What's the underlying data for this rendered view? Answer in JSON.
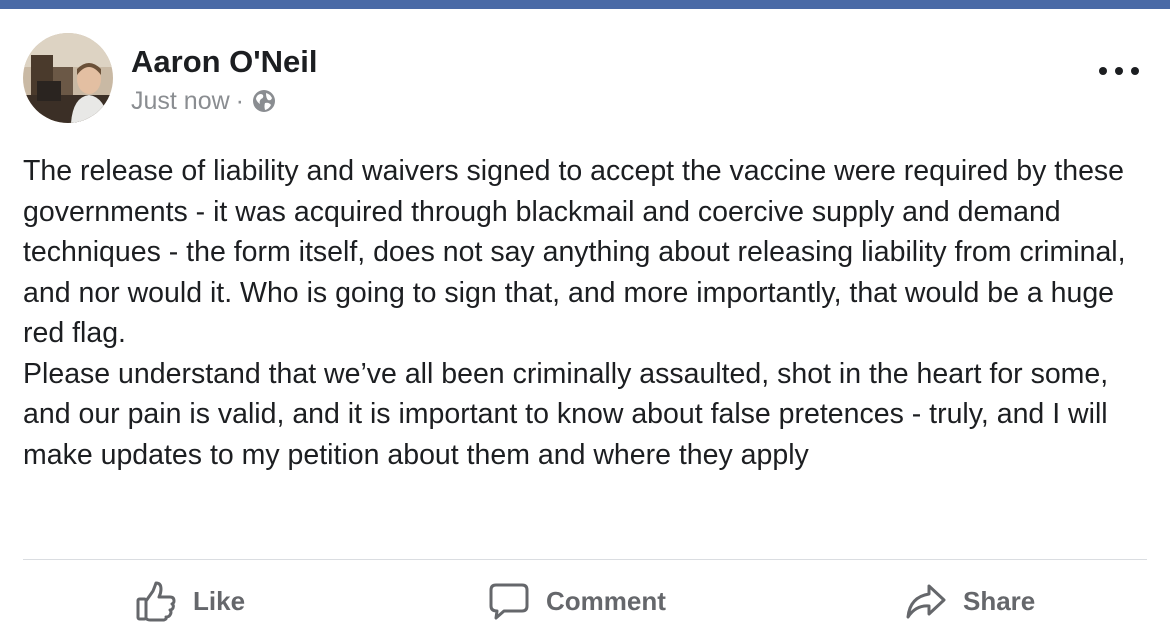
{
  "post": {
    "author": "Aaron O'Neil",
    "timestamp": "Just now",
    "separator": "·",
    "privacy_icon": "globe-icon",
    "menu_icon": "more-options-icon",
    "paragraphs": [
      "The release of liability and waivers signed to accept the vaccine were required by these governments - it was acquired through blackmail and coercive supply and demand techniques - the form itself, does not say anything about releasing liability from criminal, and nor would it. Who is going to sign that, and more importantly, that would be a huge red flag.",
      "Please understand that we’ve all been criminally assaulted, shot in the heart for some, and our pain is valid, and it is important to know about false pretences - truly, and I will make updates to my petition about them and where they apply"
    ]
  },
  "actions": {
    "like": {
      "label": "Like",
      "icon": "thumbs-up-icon"
    },
    "comment": {
      "label": "Comment",
      "icon": "comment-bubble-icon"
    },
    "share": {
      "label": "Share",
      "icon": "share-arrow-icon"
    }
  },
  "colors": {
    "top_bar": "#4a6aa6",
    "text": "#1c1e21",
    "secondary_text": "#8a8d91",
    "action_text": "#65676b",
    "divider": "#dadde1"
  }
}
